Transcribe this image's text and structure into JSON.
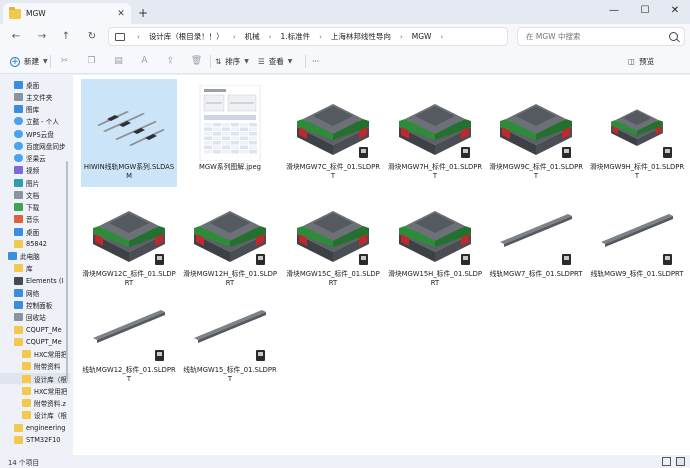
{
  "window": {
    "tab_title": "MGW",
    "tab_close": "✕",
    "new_tab": "+",
    "controls": [
      "—",
      "☐",
      "✕"
    ]
  },
  "nav": {
    "back": "←",
    "forward": "→",
    "up": "↑",
    "refresh": "↻"
  },
  "breadcrumb": [
    "设计库（根目录！！）",
    "机械",
    "1.标准件",
    "上海林邦线性导向",
    "MGW"
  ],
  "search": {
    "placeholder": "在 MGW 中搜索"
  },
  "commandbar": {
    "new_label": "新建",
    "sort_label": "排序",
    "view_label": "查看",
    "more_label": "···",
    "preview_label": "预览"
  },
  "sidebar": {
    "items": [
      {
        "label": "桌面",
        "icon": "desktop-icon"
      },
      {
        "label": "主文件夹",
        "icon": "home-icon"
      },
      {
        "label": "图库",
        "icon": "gallery-icon"
      },
      {
        "label": "立懿 - 个人",
        "icon": "cloud-icon"
      },
      {
        "label": "WPS云盘",
        "icon": "cloud-icon"
      },
      {
        "label": "百度网盘同步",
        "icon": "cloud-icon"
      },
      {
        "label": "坚果云",
        "icon": "cloud-icon"
      },
      {
        "label": "视频",
        "icon": "video-icon"
      },
      {
        "label": "图片",
        "icon": "picture-icon"
      },
      {
        "label": "文档",
        "icon": "document-icon"
      },
      {
        "label": "下载",
        "icon": "download-icon"
      },
      {
        "label": "音乐",
        "icon": "music-icon"
      },
      {
        "label": "桌面",
        "icon": "desktop-icon"
      },
      {
        "label": "85842",
        "icon": "folder-icon"
      },
      {
        "label": "此电脑",
        "icon": "computer-icon"
      },
      {
        "label": "库",
        "icon": "folder-icon"
      },
      {
        "label": "Elements (I",
        "icon": "drive-icon"
      },
      {
        "label": "网络",
        "icon": "network-icon"
      },
      {
        "label": "控制面板",
        "icon": "control-panel-icon"
      },
      {
        "label": "回收站",
        "icon": "recycle-bin-icon"
      },
      {
        "label": "CQUPT_Me",
        "icon": "folder-icon"
      },
      {
        "label": "CQUPT_Me",
        "icon": "folder-icon"
      },
      {
        "label": "HXC常用把",
        "icon": "folder-icon"
      },
      {
        "label": "附带资料",
        "icon": "folder-icon"
      },
      {
        "label": "设计库（根",
        "icon": "folder-icon"
      },
      {
        "label": "HXC常用把",
        "icon": "folder-icon"
      },
      {
        "label": "附带资料.z",
        "icon": "zip-icon"
      },
      {
        "label": "设计库（根",
        "icon": "zip-icon"
      },
      {
        "label": "engineering",
        "icon": "folder-icon"
      },
      {
        "label": "STM32F10",
        "icon": "folder-icon"
      }
    ]
  },
  "files": [
    {
      "name": "HIWIN线轨MGW系列.SLDASM",
      "type": "assembly"
    },
    {
      "name": "MGW系列图解.jpeg",
      "type": "jpeg"
    },
    {
      "name": "滑块MGW7C_标件_01.SLDPRT",
      "type": "block"
    },
    {
      "name": "滑块MGW7H_标件_01.SLDPRT",
      "type": "block"
    },
    {
      "name": "滑块MGW9C_标件_01.SLDPRT",
      "type": "block"
    },
    {
      "name": "滑块MGW9H_标件_01.SLDPRT",
      "type": "block-small"
    },
    {
      "name": "滑块MGW12C_标件_01.SLDPRT",
      "type": "block"
    },
    {
      "name": "滑块MGW12H_标件_01.SLDPRT",
      "type": "block"
    },
    {
      "name": "滑块MGW15C_标件_01.SLDPRT",
      "type": "block"
    },
    {
      "name": "滑块MGW15H_标件_01.SLDPRT",
      "type": "block"
    },
    {
      "name": "线轨MGW7_标件_01.SLDPRT",
      "type": "rail"
    },
    {
      "name": "线轨MGW9_标件_01.SLDPRT",
      "type": "rail"
    },
    {
      "name": "线轨MGW12_标件_01.SLDPRT",
      "type": "rail"
    },
    {
      "name": "线轨MGW15_标件_01.SLDPRT",
      "type": "rail"
    }
  ],
  "status": {
    "count": "14 个项目"
  },
  "colors": {
    "block_green": "#2e8b3a",
    "block_red": "#c0282d",
    "block_gray": "#5d6167",
    "selection": "#cce4f7"
  }
}
